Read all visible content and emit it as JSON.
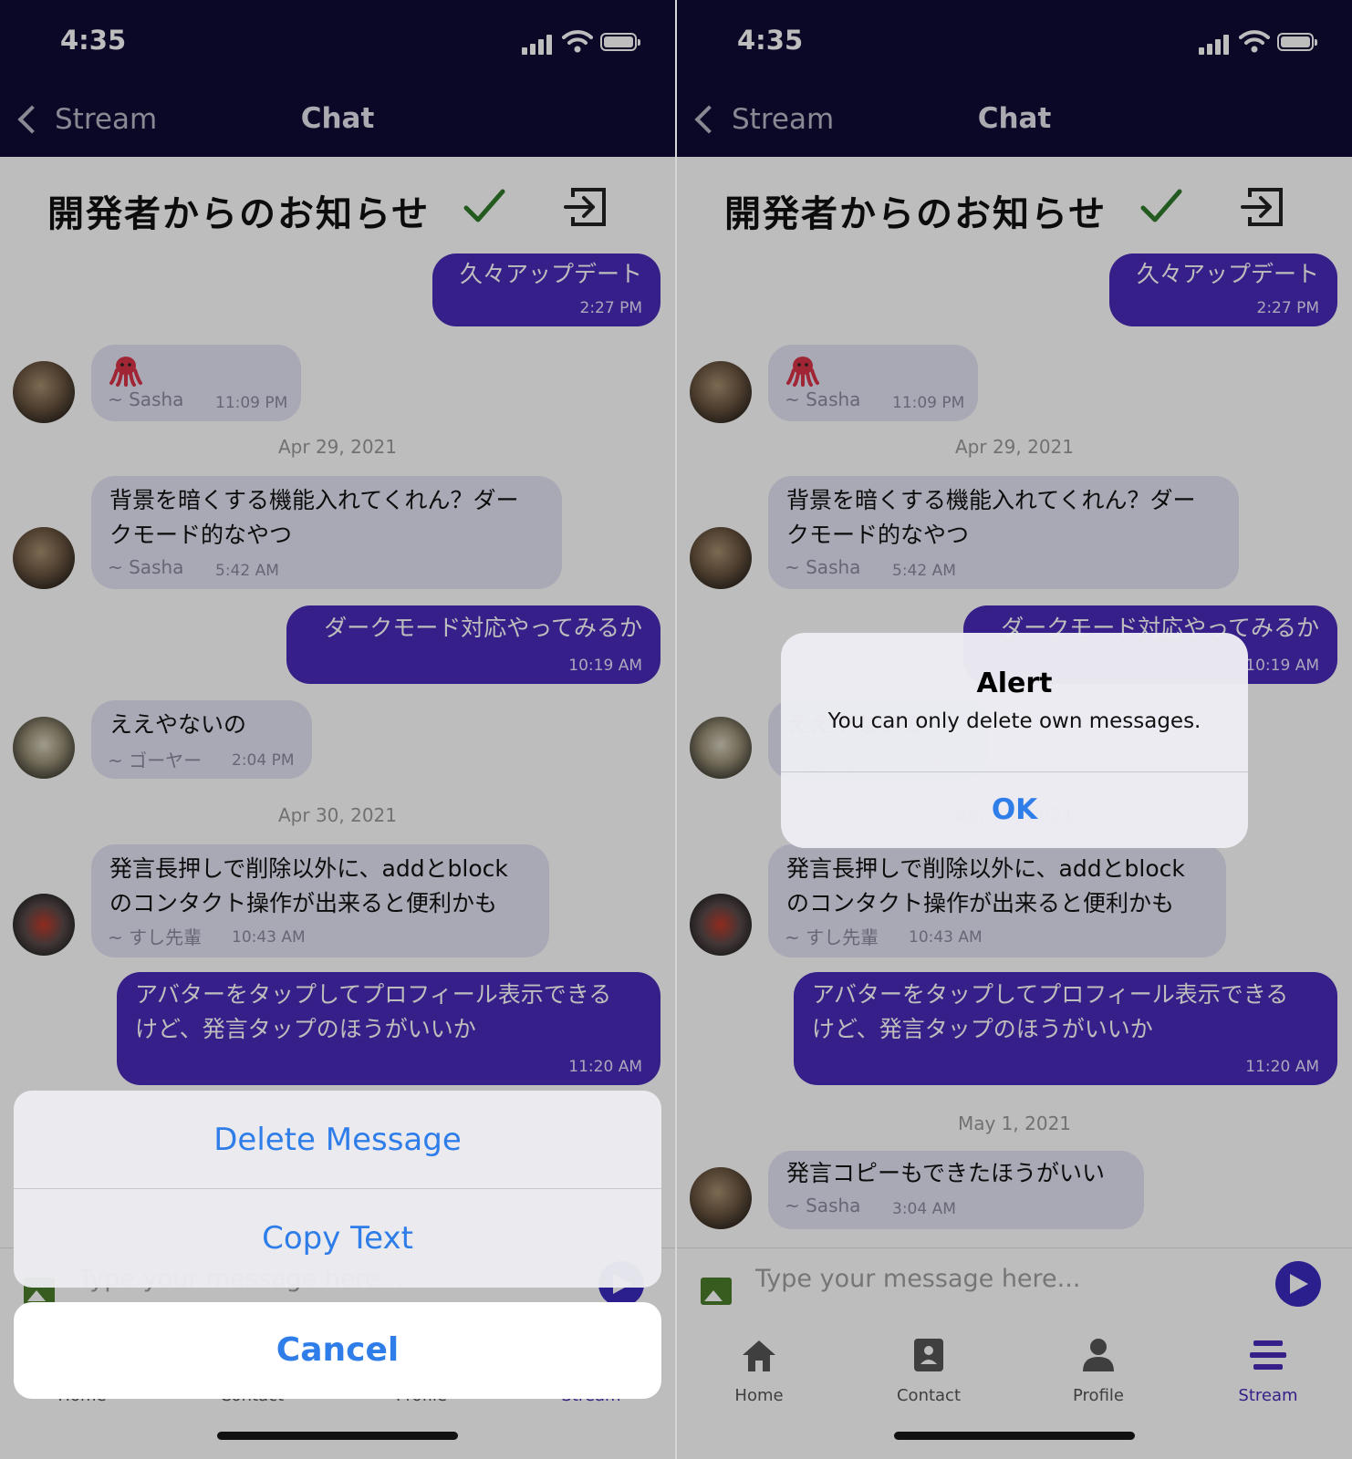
{
  "status": {
    "time": "4:35"
  },
  "nav": {
    "back_label": "Stream",
    "title": "Chat"
  },
  "room": {
    "title": "開発者からのお知らせ"
  },
  "messages": {
    "m1": {
      "text": "久々アップデート",
      "time": "2:27 PM"
    },
    "m2": {
      "sender": "~ Sasha",
      "time": "11:09 PM",
      "emoji": "octopus"
    },
    "date1": "Apr 29, 2021",
    "m3": {
      "line1": "背景を暗くする機能入れてくれん？ダー",
      "line2": "クモード的なやつ",
      "sender": "~ Sasha",
      "time": "5:42 AM"
    },
    "m4": {
      "text": "ダークモード対応やってみるか",
      "time": "10:19 AM"
    },
    "m5": {
      "text": "ええやないの",
      "sender": "~ ゴーヤー",
      "time": "2:04 PM"
    },
    "date2": "Apr 30, 2021",
    "m6": {
      "line1": "発言長押しで削除以外に、addとblock",
      "line2": "のコンタクト操作が出来ると便利かも",
      "sender": "~ すし先輩",
      "time": "10:43 AM"
    },
    "m7": {
      "line1": "アバターをタップしてプロフィール表示できる",
      "line2": "けど、発言タップのほうがいいか",
      "time": "11:20 AM"
    },
    "date3": "May 1, 2021",
    "m8": {
      "text": "発言コピーもできたほうがいい",
      "sender": "~ Sasha",
      "time": "3:04 AM"
    }
  },
  "composer": {
    "placeholder": "Type your message here..."
  },
  "tabs": [
    {
      "label": "Home",
      "icon": "home-icon"
    },
    {
      "label": "Contact",
      "icon": "contact-card-icon"
    },
    {
      "label": "Profile",
      "icon": "person-icon"
    },
    {
      "label": "Stream",
      "icon": "stream-lines-icon"
    }
  ],
  "action_sheet": {
    "delete": "Delete Message",
    "copy": "Copy Text",
    "cancel": "Cancel"
  },
  "alert": {
    "title": "Alert",
    "message": "You can only delete own messages.",
    "ok": "OK"
  },
  "colors": {
    "navbar": "#0f0c35",
    "outgoing_bubble": "#4a2ab8",
    "incoming_bubble": "#e4e4f6",
    "action_blue": "#2e7de9"
  }
}
